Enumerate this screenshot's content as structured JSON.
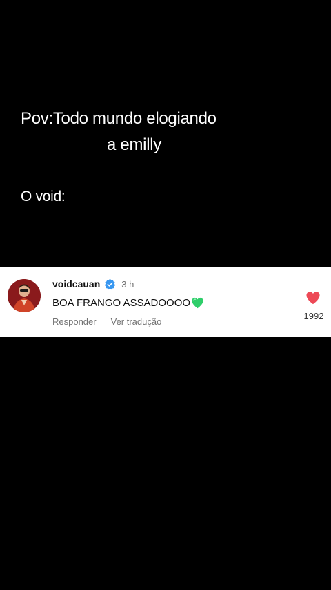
{
  "caption": {
    "line1": "Pov:Todo mundo elogiando",
    "line2": "a emilly",
    "line3": "O void:"
  },
  "comment": {
    "username": "voidcauan",
    "time": "3 h",
    "text": "BOA FRANGO ASSADOOOO",
    "text_emoji": "green-heart-icon",
    "reply_label": "Responder",
    "translate_label": "Ver tradução",
    "like_count": "1992",
    "like_icon": "heart-icon",
    "verified_icon": "verified-badge-icon",
    "colors": {
      "verified": "#3897f0",
      "like_heart": "#ed4956",
      "green_heart": "#2fce6a"
    }
  }
}
